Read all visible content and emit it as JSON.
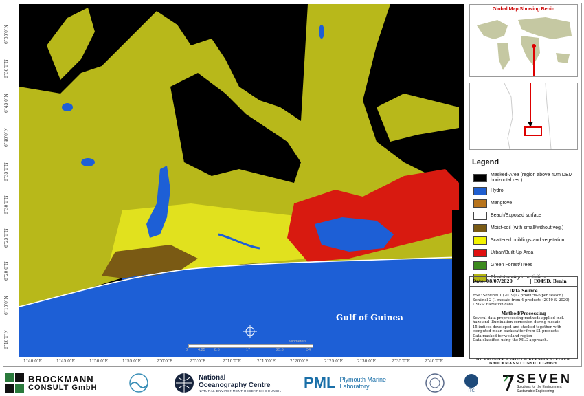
{
  "map": {
    "gulf_label": "Gulf of Guinea",
    "lat_labels": [
      "6°55'0\"N",
      "6°50'0\"N",
      "6°45'0\"N",
      "6°40'0\"N",
      "6°35'0\"N",
      "6°30'0\"N",
      "6°25'0\"N",
      "6°20'0\"N",
      "6°15'0\"N",
      "6°10'0\"N"
    ],
    "lon_labels": [
      "1°40'0\"E",
      "1°45'0\"E",
      "1°50'0\"E",
      "1°55'0\"E",
      "2°0'0\"E",
      "2°5'0\"E",
      "2°10'0\"E",
      "2°15'0\"E",
      "2°20'0\"E",
      "2°25'0\"E",
      "2°30'0\"E",
      "2°35'0\"E",
      "2°40'0\"E"
    ],
    "scale": {
      "ticks": [
        "0",
        "4.25",
        "8.5",
        "17",
        "25.5",
        "34"
      ],
      "unit": "Kilometers"
    }
  },
  "globe": {
    "title": "Global Map Showing Benin"
  },
  "legend": {
    "title": "Legend",
    "items": [
      {
        "label": "Masked-Area (region above 40m DEM horizontal res.)",
        "color": "#000000"
      },
      {
        "label": "Hydro",
        "color": "#1f5fd0"
      },
      {
        "label": "Mangrove",
        "color": "#b8741c"
      },
      {
        "label": "Beach/Exposed surface",
        "color": "#ffffff"
      },
      {
        "label": "Moist-soil (with small/without veg.)",
        "color": "#7a5a14"
      },
      {
        "label": "Scattered buildings and vegetation",
        "color": "#f2f200"
      },
      {
        "label": "Urban/Built-Up Area",
        "color": "#e01010"
      },
      {
        "label": "Green Forest/Trees",
        "color": "#3c8a1e"
      },
      {
        "label": "Plantation/Agric. activities",
        "color": "#b5b514"
      }
    ]
  },
  "info": {
    "date": "Date: 08/07/2020",
    "project": "EO4SD: Benin",
    "data_source_title": "Data Source",
    "data_source": [
      "ESA: Sentinel 1 (2019(12 products-6 per season)",
      "Sentinel 2 (1 mosaic from 4 products (2019 & 2020)",
      "USGS: Elevation data"
    ],
    "method_title": "Method/Processing",
    "method": [
      "Several data preprocessing methods applied incl.",
      "haze and illumination correction during mosaic",
      "15 indices developed and stacked together with",
      "computed mean backscatter from S1 products.",
      "Data masked for wetland region",
      "Data classified using the MLC approach."
    ],
    "authors": "BY: PROSPER EVADZI & KERSTIN STELZER BROCKMANN CONSULT GMBH"
  },
  "footer": {
    "brockmann_1": "BROCKMANN",
    "brockmann_2": "CONSULT GmbH",
    "noc_1": "National",
    "noc_2": "Oceanography Centre",
    "noc_sub": "NATURAL ENVIRONMENT RESEARCH COUNCIL",
    "pml": "PML",
    "pml_1": "Plymouth Marine",
    "pml_2": "Laboratory",
    "seven": "SEVEN",
    "seven_sub_1": "Solutions for the Environment",
    "seven_sub_2": "Sustainable Engineering"
  }
}
